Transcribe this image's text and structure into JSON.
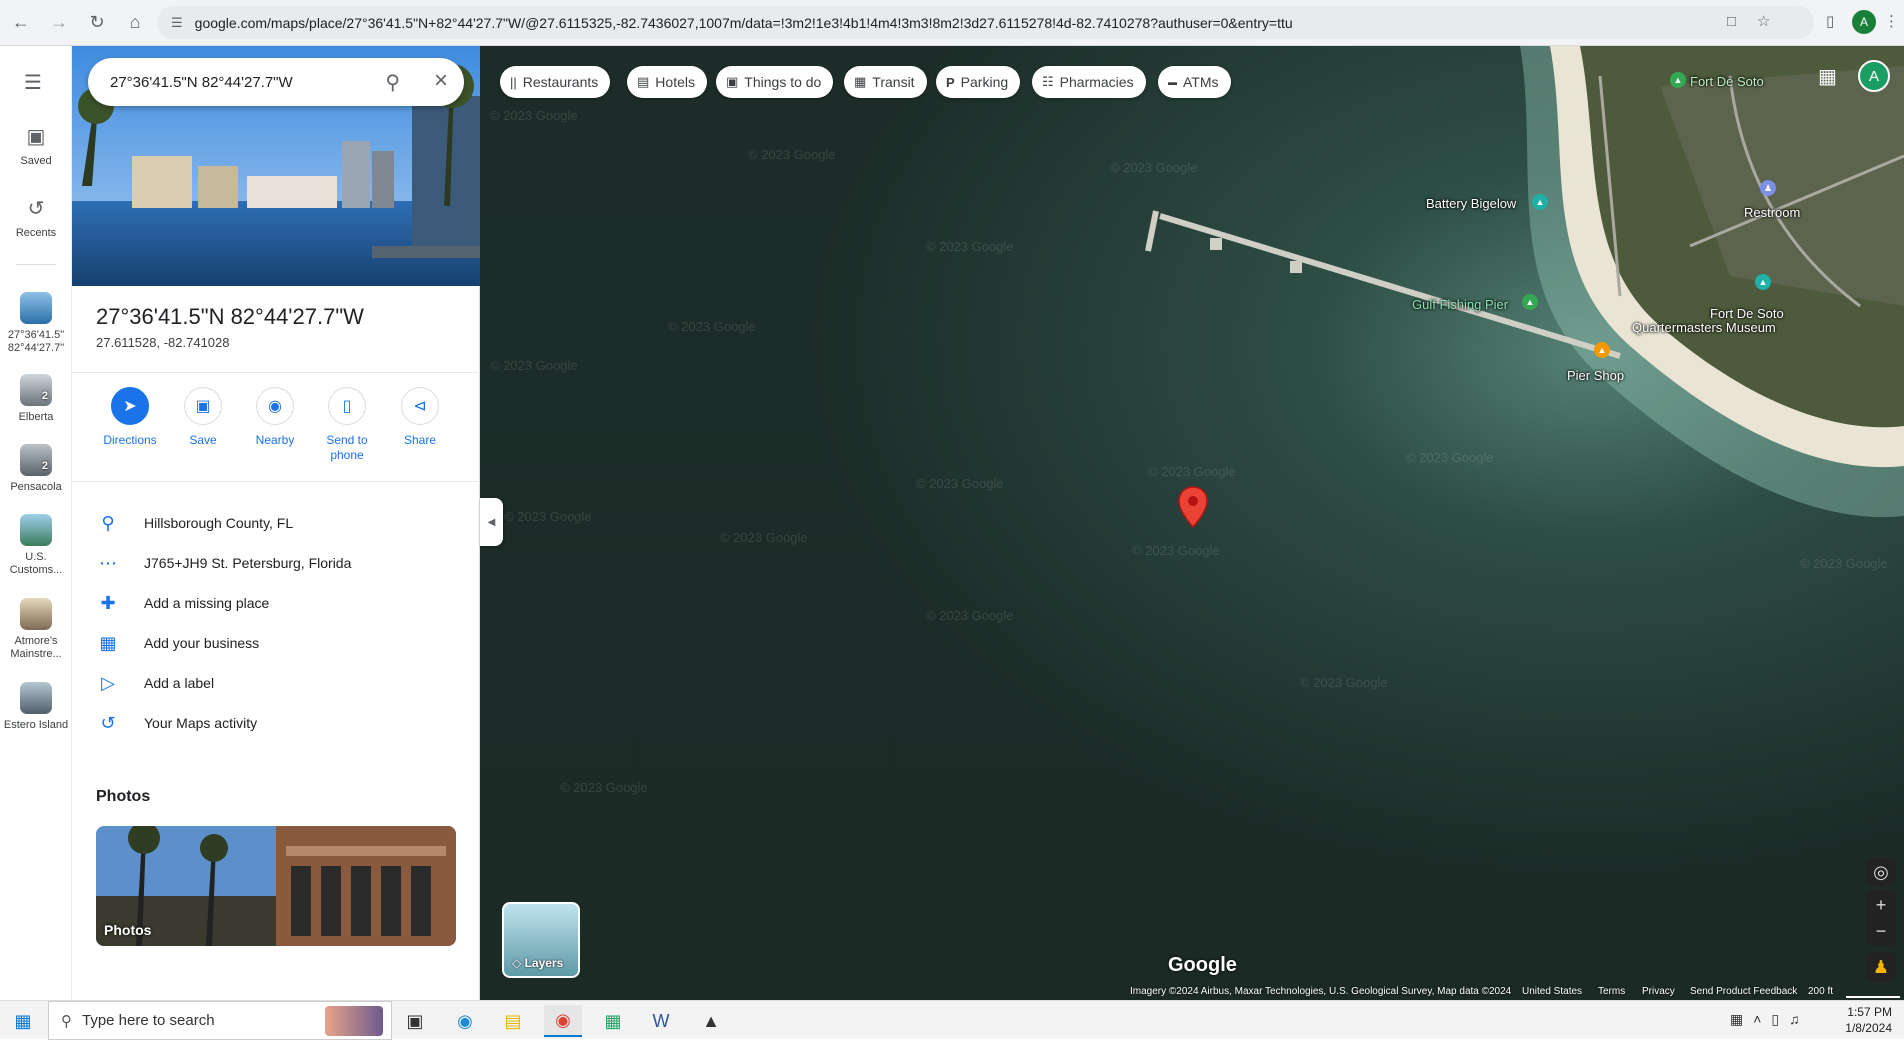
{
  "browser": {
    "url": "google.com/maps/place/27°36'41.5\"N+82°44'27.7\"W/@27.6115325,-82.7436027,1007m/data=!3m2!1e3!4b1!4m4!3m3!8m2!3d27.6115278!4d-82.7410278?authuser=0&entry=ttu",
    "profile_initial": "A"
  },
  "rail": {
    "saved_label": "Saved",
    "recents_label": "Recents",
    "recents": [
      {
        "label": "27°36'41.5\" 82°44'27.7\"",
        "badge": ""
      },
      {
        "label": "Elberta",
        "badge": "2"
      },
      {
        "label": "Pensacola",
        "badge": "2"
      },
      {
        "label": "U.S. Customs...",
        "badge": ""
      },
      {
        "label": "Atmore's Mainstre...",
        "badge": ""
      },
      {
        "label": "Estero Island",
        "badge": ""
      }
    ]
  },
  "search": {
    "value": "27°36'41.5\"N 82°44'27.7\"W"
  },
  "place": {
    "title": "27°36'41.5\"N 82°44'27.7\"W",
    "decimal_coords": "27.611528, -82.741028",
    "actions": [
      {
        "label": "Directions",
        "icon": "directions-icon"
      },
      {
        "label": "Save",
        "icon": "bookmark-icon"
      },
      {
        "label": "Nearby",
        "icon": "nearby-icon"
      },
      {
        "label": "Send to phone",
        "icon": "send-to-phone-icon"
      },
      {
        "label": "Share",
        "icon": "share-icon"
      }
    ],
    "info_rows": [
      {
        "text": "Hillsborough County, FL",
        "icon": "location-pin-icon"
      },
      {
        "text": "J765+JH9 St. Petersburg, Florida",
        "icon": "plus-code-icon"
      },
      {
        "text": "Add a missing place",
        "icon": "add-place-icon"
      },
      {
        "text": "Add your business",
        "icon": "add-business-icon"
      },
      {
        "text": "Add a label",
        "icon": "label-icon"
      },
      {
        "text": "Your Maps activity",
        "icon": "history-icon"
      }
    ],
    "photos_heading": "Photos",
    "photos_overlay_label": "Photos"
  },
  "map": {
    "chips": [
      {
        "label": "Restaurants",
        "icon": "restaurant-icon"
      },
      {
        "label": "Hotels",
        "icon": "hotel-icon"
      },
      {
        "label": "Things to do",
        "icon": "camera-icon"
      },
      {
        "label": "Transit",
        "icon": "transit-icon"
      },
      {
        "label": "Parking",
        "icon": "parking-icon"
      },
      {
        "label": "Pharmacies",
        "icon": "pharmacy-icon"
      },
      {
        "label": "ATMs",
        "icon": "atm-icon"
      }
    ],
    "places": {
      "fort_de_soto": "Fort De Soto",
      "battery_bigelow": "Battery Bigelow",
      "restroom": "Restroom",
      "gulf_pier": "Gulf Fishing Pier",
      "museum_line1": "Fort De Soto",
      "museum_line2": "Quartermasters Museum",
      "pier_shop": "Pier Shop"
    },
    "watermark": "© 2023 Google",
    "layers_label": "Layers",
    "logo": "Google",
    "attribution": "Imagery ©2024 Airbus, Maxar Technologies, U.S. Geological Survey, Map data ©2024",
    "footer_links": [
      "United States",
      "Terms",
      "Privacy",
      "Send Product Feedback"
    ],
    "scale": "200 ft",
    "colors": {
      "water": "#1c2b27",
      "pin": "#ea4335",
      "accent": "#1a73e8",
      "poi_teal": "#1fb0a8"
    }
  },
  "taskbar": {
    "search_placeholder": "Type here to search",
    "time": "1:57 PM",
    "date": "1/8/2024"
  }
}
